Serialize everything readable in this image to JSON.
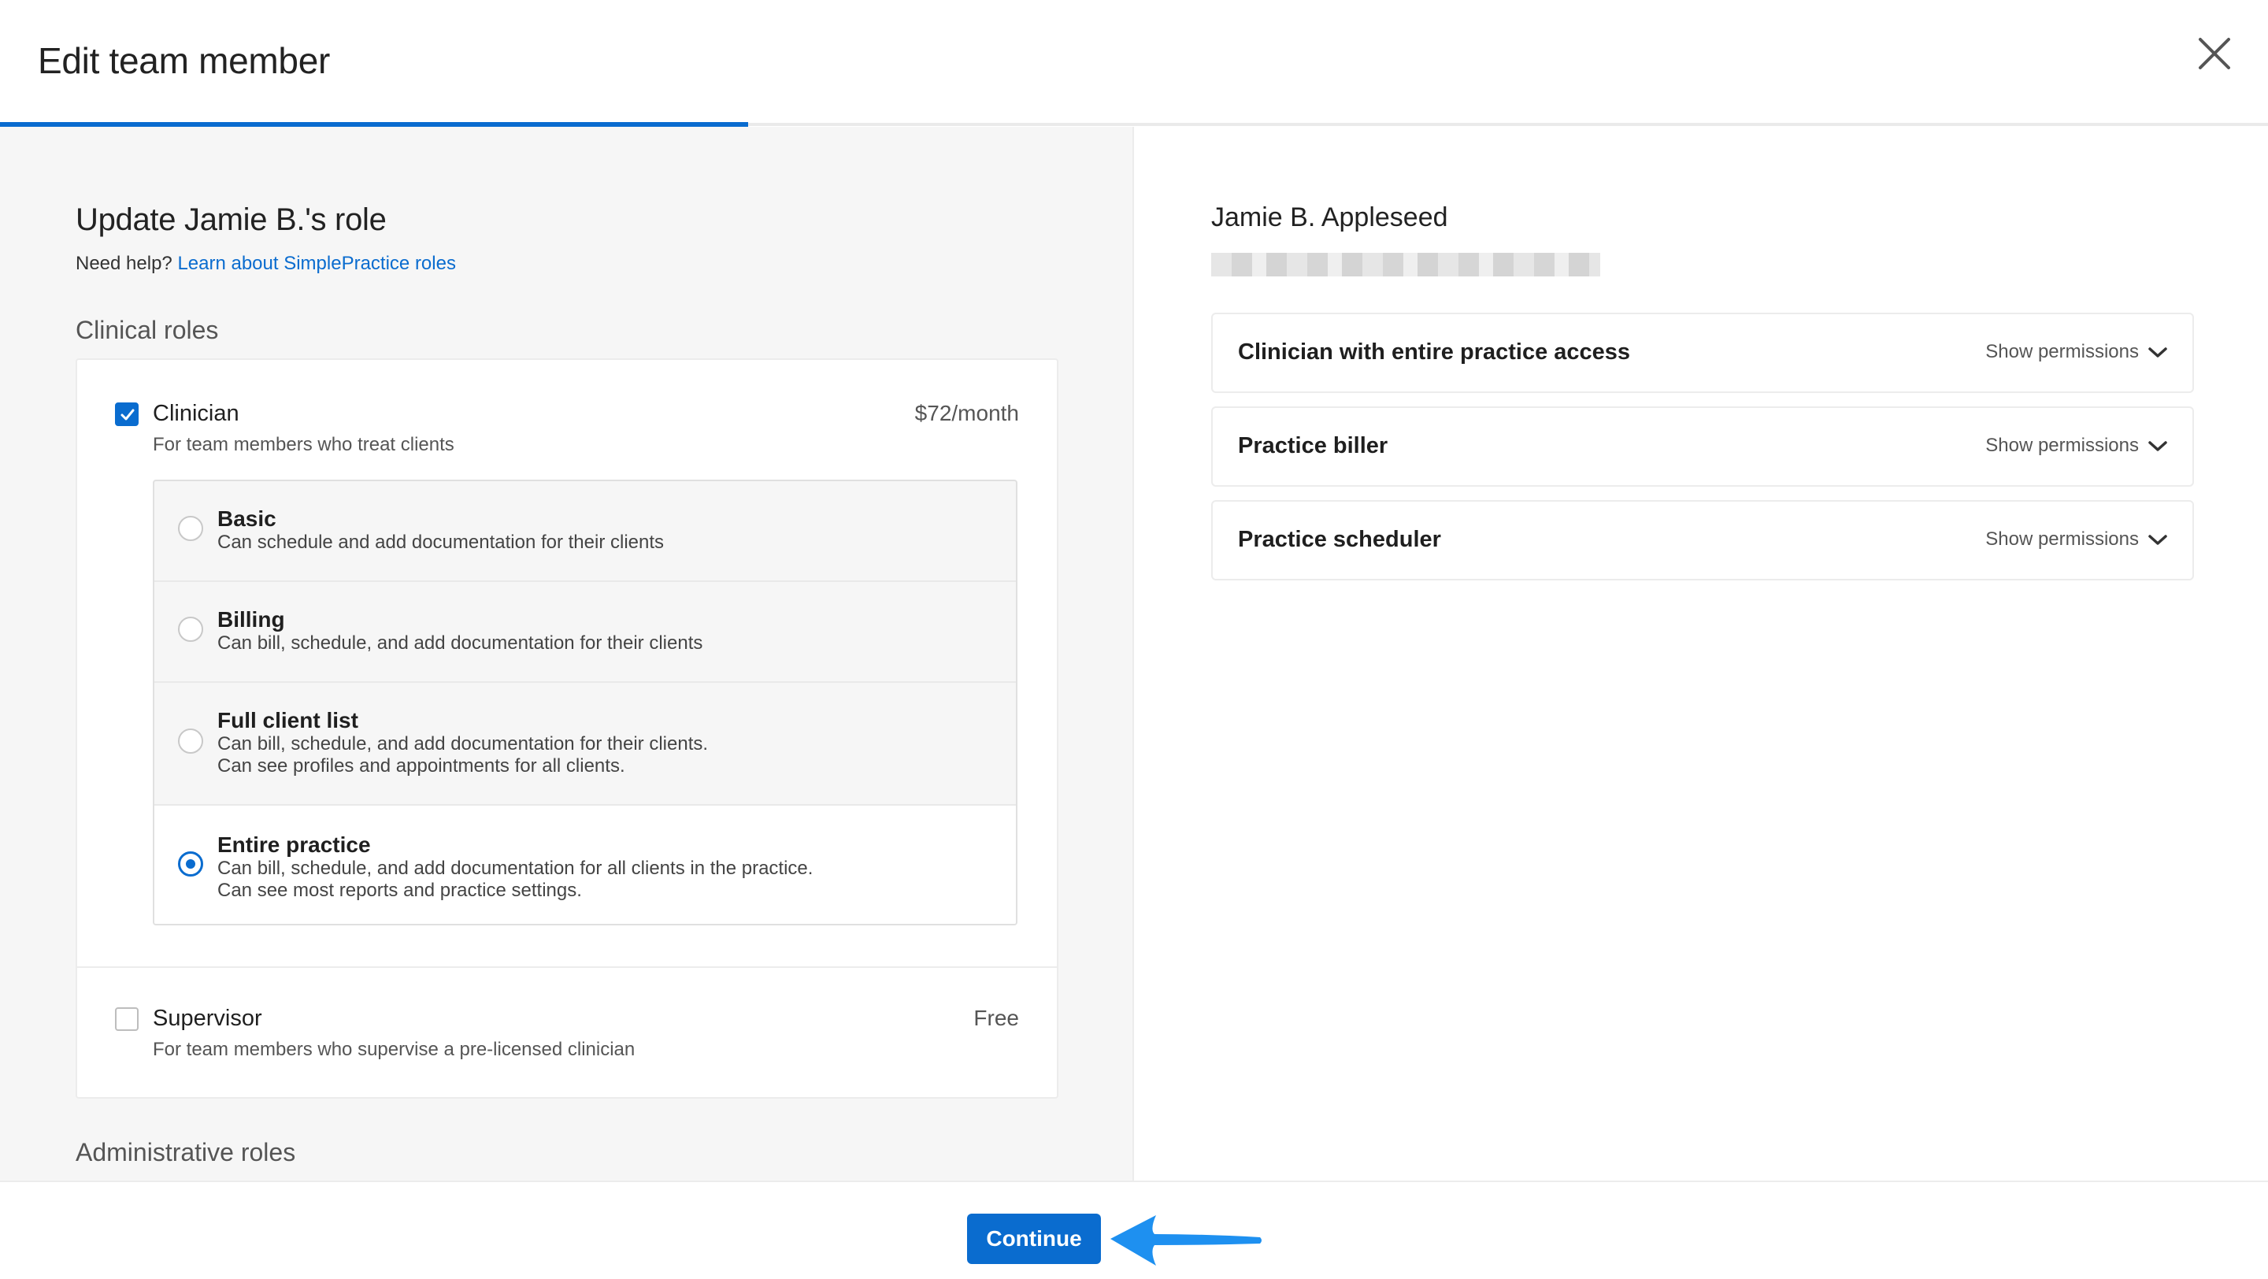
{
  "header": {
    "title": "Edit team member",
    "close_icon": "close-icon",
    "progress_fraction": 0.33
  },
  "left": {
    "page_title": "Update Jamie B.'s role",
    "help_prefix": "Need help?",
    "help_link": "Learn about SimplePractice roles",
    "clinical_section": "Clinical roles",
    "admin_section": "Administrative roles",
    "clinician": {
      "name": "Clinician",
      "desc": "For team members who treat clients",
      "price": "$72/month",
      "checked": true
    },
    "sub_options": [
      {
        "title": "Basic",
        "desc1": "Can schedule and add documentation for their clients",
        "desc2": "",
        "selected": false
      },
      {
        "title": "Billing",
        "desc1": "Can bill, schedule, and add documentation for their clients",
        "desc2": "",
        "selected": false
      },
      {
        "title": "Full client list",
        "desc1": "Can bill, schedule, and add documentation for their clients.",
        "desc2": "Can see profiles and appointments for all clients.",
        "selected": false
      },
      {
        "title": "Entire practice",
        "desc1": "Can bill, schedule, and add documentation for all clients in the practice.",
        "desc2": "Can see most reports and practice settings.",
        "selected": true
      }
    ],
    "supervisor": {
      "name": "Supervisor",
      "desc": "For team members who supervise a pre-licensed clinician",
      "price": "Free",
      "checked": false
    }
  },
  "right": {
    "member_name": "Jamie B. Appleseed",
    "permissions": [
      {
        "title": "Clinician with entire practice access",
        "toggle": "Show permissions"
      },
      {
        "title": "Practice biller",
        "toggle": "Show permissions"
      },
      {
        "title": "Practice scheduler",
        "toggle": "Show permissions"
      }
    ]
  },
  "footer": {
    "continue_label": "Continue",
    "accent_color": "#0a6ccf",
    "arrow_color": "#1e90f0"
  }
}
